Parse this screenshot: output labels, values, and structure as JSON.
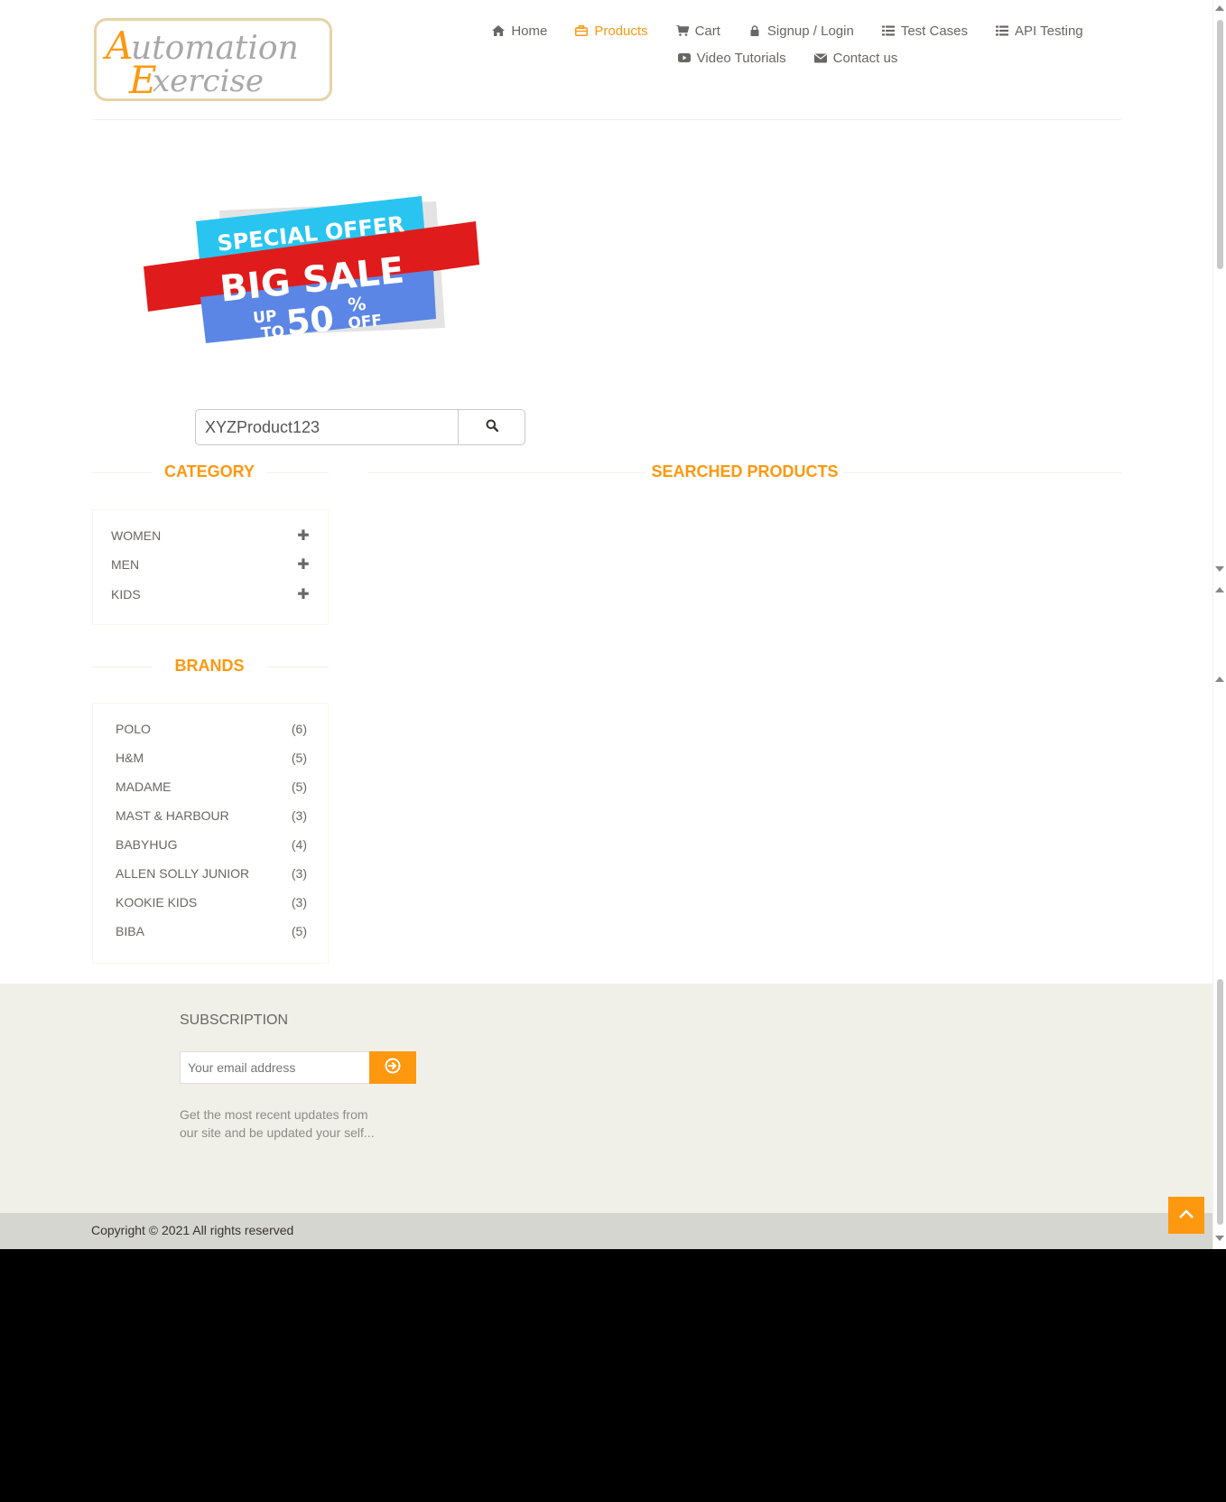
{
  "logo": {
    "line1_first": "A",
    "line1_rest": "utomation",
    "line2_first": "E",
    "line2_rest": "xercise"
  },
  "nav": {
    "items": [
      {
        "label": "Home",
        "icon": "home-icon"
      },
      {
        "label": "Products",
        "icon": "briefcase-icon",
        "active": true
      },
      {
        "label": "Cart",
        "icon": "cart-icon"
      },
      {
        "label": "Signup / Login",
        "icon": "lock-icon"
      },
      {
        "label": "Test Cases",
        "icon": "list-icon"
      },
      {
        "label": "API Testing",
        "icon": "list-icon"
      },
      {
        "label": "Video Tutorials",
        "icon": "youtube-icon"
      },
      {
        "label": "Contact us",
        "icon": "envelope-icon"
      }
    ]
  },
  "banner": {
    "line1": "SPECIAL OFFER",
    "line2": "BIG SALE",
    "up": "UP",
    "to": "TO",
    "percent": "50",
    "pct_sign": "%",
    "off": "OFF"
  },
  "search": {
    "value": "XYZProduct123",
    "icon": "search-icon"
  },
  "sections": {
    "category": "CATEGORY",
    "searched": "SEARCHED PRODUCTS",
    "brands": "BRANDS"
  },
  "categories": [
    {
      "label": "WOMEN",
      "expand": "✚"
    },
    {
      "label": "MEN",
      "expand": "✚"
    },
    {
      "label": "KIDS",
      "expand": "✚"
    }
  ],
  "brands": [
    {
      "name": "POLO",
      "count": "(6)"
    },
    {
      "name": "H&M",
      "count": "(5)"
    },
    {
      "name": "MADAME",
      "count": "(5)"
    },
    {
      "name": "MAST & HARBOUR",
      "count": "(3)"
    },
    {
      "name": "BABYHUG",
      "count": "(4)"
    },
    {
      "name": "ALLEN SOLLY JUNIOR",
      "count": "(3)"
    },
    {
      "name": "KOOKIE KIDS",
      "count": "(3)"
    },
    {
      "name": "BIBA",
      "count": "(5)"
    }
  ],
  "footer": {
    "subscription_title": "SUBSCRIPTION",
    "email_placeholder": "Your email address",
    "subscribe_icon": "arrow-circle-right-icon",
    "description": "Get the most recent updates from our site and be updated your self...",
    "copyright": "Copyright © 2021 All rights reserved"
  },
  "colors": {
    "accent": "#fe980f",
    "text": "#696763",
    "footer_bg": "#f0f0e9",
    "copyright_bg": "#d6d6d0"
  }
}
